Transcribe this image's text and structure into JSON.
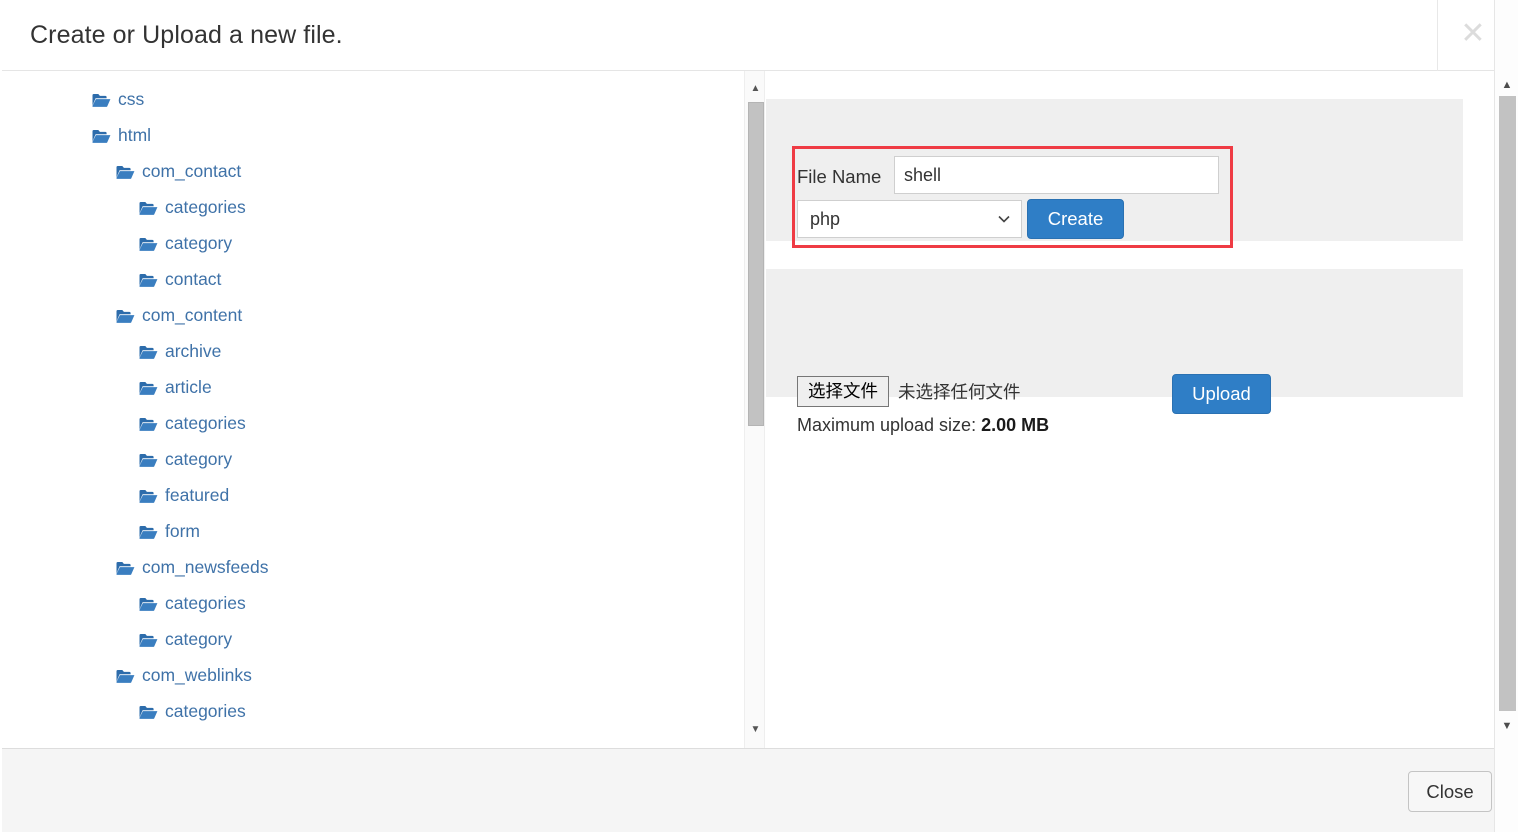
{
  "header": {
    "title": "Create or Upload a new file.",
    "close_icon": "close-x-icon"
  },
  "tree": {
    "items": [
      {
        "label": "css",
        "depth": 0,
        "icon": "folder-open-icon"
      },
      {
        "label": "html",
        "depth": 0,
        "icon": "folder-open-icon"
      },
      {
        "label": "com_contact",
        "depth": 1,
        "icon": "folder-open-icon"
      },
      {
        "label": "categories",
        "depth": 2,
        "icon": "folder-open-icon"
      },
      {
        "label": "category",
        "depth": 2,
        "icon": "folder-open-icon"
      },
      {
        "label": "contact",
        "depth": 2,
        "icon": "folder-open-icon"
      },
      {
        "label": "com_content",
        "depth": 1,
        "icon": "folder-open-icon"
      },
      {
        "label": "archive",
        "depth": 2,
        "icon": "folder-open-icon"
      },
      {
        "label": "article",
        "depth": 2,
        "icon": "folder-open-icon"
      },
      {
        "label": "categories",
        "depth": 2,
        "icon": "folder-open-icon"
      },
      {
        "label": "category",
        "depth": 2,
        "icon": "folder-open-icon"
      },
      {
        "label": "featured",
        "depth": 2,
        "icon": "folder-open-icon"
      },
      {
        "label": "form",
        "depth": 2,
        "icon": "folder-open-icon"
      },
      {
        "label": "com_newsfeeds",
        "depth": 1,
        "icon": "folder-open-icon"
      },
      {
        "label": "categories",
        "depth": 2,
        "icon": "folder-open-icon"
      },
      {
        "label": "category",
        "depth": 2,
        "icon": "folder-open-icon"
      },
      {
        "label": "com_weblinks",
        "depth": 1,
        "icon": "folder-open-icon"
      },
      {
        "label": "categories",
        "depth": 2,
        "icon": "folder-open-icon"
      }
    ]
  },
  "create_panel": {
    "file_name_label": "File Name",
    "file_name_value": "shell",
    "file_name_placeholder": "",
    "extension_selected": "php",
    "extension_options": [
      "php"
    ],
    "create_button": "Create",
    "highlight_color": "#ef3b44"
  },
  "upload_panel": {
    "choose_file_button": "选择文件",
    "no_file_text": "未选择任何文件",
    "max_size_prefix": "Maximum upload size: ",
    "max_size_value": "2.00 MB",
    "upload_button": "Upload"
  },
  "footer": {
    "close_button": "Close"
  },
  "scrollbars": {
    "up_arrow": "▲",
    "down_arrow": "▼"
  },
  "colors": {
    "accent_blue": "#2f7ec6",
    "link_blue": "#3f72a8",
    "panel_gray": "#efefef",
    "footer_gray": "#f5f5f5",
    "highlight_red": "#ef3b44"
  }
}
